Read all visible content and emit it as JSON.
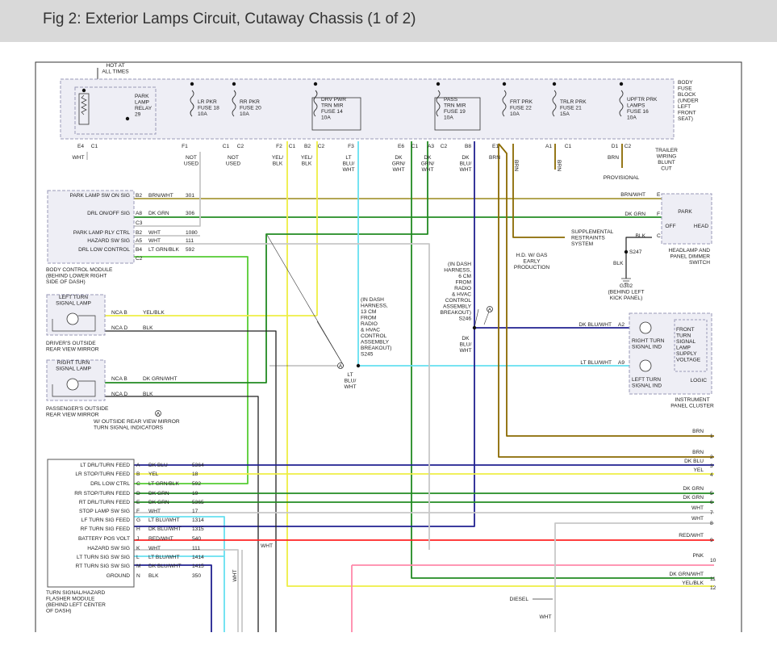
{
  "title": "Fig 2: Exterior Lamps Circuit, Cutaway Chassis (1 of 2)",
  "fuse_block": {
    "hot_label": [
      "HOT AT",
      "ALL TIMES"
    ],
    "relay": [
      "PARK",
      "LAMP",
      "RELAY",
      "29"
    ],
    "fuses": [
      [
        "LR PKR",
        "FUSE 18",
        "10A"
      ],
      [
        "RR PKR",
        "FUSE 20",
        "10A"
      ],
      [
        "DRV PWR",
        "TRN MIR",
        "FUSE 14",
        "10A"
      ],
      [
        "PASS",
        "TRN MIR",
        "FUSE 19",
        "10A"
      ],
      [
        "FRT PRK",
        "FUSE 22",
        "10A"
      ],
      [
        "TRLR PRK",
        "FUSE 21",
        "15A"
      ],
      [
        "UPFTR PRK",
        "LAMPS",
        "FUSE 16",
        "10A"
      ]
    ],
    "block_label": [
      "BODY",
      "FUSE",
      "BLOCK",
      "(UNDER",
      "LEFT",
      "FRONT",
      "SEAT)"
    ],
    "pins": [
      "E4",
      "C1",
      "F1",
      "C1",
      "C2",
      "F2",
      "C1",
      "B2",
      "C2",
      "F3",
      "E6",
      "C1",
      "A3",
      "C2",
      "B8",
      "E1",
      "A1",
      "C1",
      "D1",
      "C2"
    ],
    "wire_labels": [
      [
        "WHT"
      ],
      [
        "NOT",
        "USED"
      ],
      [
        "NOT",
        "USED"
      ],
      [
        "YEL/",
        "BLK"
      ],
      [
        "YEL/",
        "BLK"
      ],
      [
        "LT",
        "BLU/",
        "WHT"
      ],
      [
        "DK",
        "GRN/",
        "WHT"
      ],
      [
        "DK",
        "GRN/",
        "WHT"
      ],
      [
        "DK",
        "BLU/",
        "WHT"
      ],
      [
        "BRN"
      ],
      [
        "BRN"
      ],
      [
        "BRN"
      ],
      [
        "BRN"
      ]
    ],
    "trailer": [
      "TRAILER",
      "WIRING",
      "BLUNT",
      "CUT"
    ],
    "provisional": "PROVISIONAL"
  },
  "bcm": {
    "rows": [
      {
        "label": "PARK LAMP SW ON SIG",
        "pin": "B2",
        "wire": "BRN/WHT",
        "num": "301"
      },
      {
        "label": "DRL ON/OFF SIG",
        "pin": "A8",
        "wire": "DK GRN",
        "num": "306"
      },
      {
        "label": "",
        "pin": "C3",
        "wire": "",
        "num": ""
      },
      {
        "label": "PARK LAMP RLY CTRL",
        "pin": "B2",
        "wire": "WHT",
        "num": "1080"
      },
      {
        "label": "HAZARD SW SIG",
        "pin": "A5",
        "wire": "WHT",
        "num": "111"
      },
      {
        "label": "DRL LOW CONTROL",
        "pin": "B4",
        "wire": "LT GRN/BLK",
        "num": "592"
      },
      {
        "label": "",
        "pin": "C2",
        "wire": "",
        "num": ""
      }
    ],
    "caption": [
      "BODY CONTROL MODULE",
      "(BEHIND LOWER RIGHT",
      "SIDE OF DASH)"
    ]
  },
  "mirrors": {
    "left_lamp": [
      "LEFT TURN",
      "SIGNAL LAMP"
    ],
    "left_caption": [
      "DRIVER'S OUTSIDE",
      "REAR VIEW MIRROR"
    ],
    "right_lamp": [
      "RIGHT TURN",
      "SIGNAL LAMP"
    ],
    "right_caption": [
      "PASSENGER'S OUTSIDE",
      "REAR VIEW MIRROR"
    ],
    "pins": [
      "NCA B",
      "NCA D",
      "NCA B",
      "NCA D"
    ],
    "wires": [
      "YEL/BLK",
      "BLK",
      "DK GRN/WHT",
      "BLK"
    ],
    "note_marker": "A",
    "note": [
      "W/ OUTSIDE REAR VIEW MIRROR",
      "TURN SIGNAL INDICATORS"
    ]
  },
  "harness_notes": {
    "s245": [
      "(IN DASH",
      "HARNESS,",
      "13 CM",
      "FROM",
      "RADIO",
      "& HVAC",
      "CONTROL",
      "ASSEMBLY",
      "BREAKOUT)",
      "S245"
    ],
    "s245_wire": [
      "LT",
      "BLU/",
      "WHT"
    ],
    "s246": [
      "(IN DASH",
      "HARNESS,",
      "6 CM",
      "FROM",
      "RADIO",
      "& HVAC",
      "CONTROL",
      "ASSEMBLY",
      "BREAKOUT)",
      "S246"
    ],
    "s246_wire": [
      "DK",
      "BLU/",
      "WHT"
    ],
    "marker": "A"
  },
  "right_side": {
    "srs": [
      "SUPPLEMENTAL",
      "RESTRAINTS",
      "SYSTEM"
    ],
    "hd": [
      "H.D. W/ GAS",
      "EARLY",
      "PRODUCTION"
    ],
    "switch_labels": [
      "PARK",
      "OFF",
      "HEAD"
    ],
    "switch_pins": [
      "E",
      "F",
      "C"
    ],
    "switch_wires": [
      "BRN/WHT",
      "DK GRN",
      "BLK"
    ],
    "switch_caption": [
      "HEADLAMP AND",
      "PANEL DIMMER",
      "SWITCH"
    ],
    "s247": "S247",
    "s247_wire": "BLK",
    "g302": [
      "G302",
      "(BEHIND LEFT",
      "KICK PANEL)"
    ],
    "cluster_wires": [
      "DK BLU/WHT",
      "LT BLU/WHT"
    ],
    "cluster_pins": [
      "A2",
      "A9"
    ],
    "right_ind": [
      "RIGHT TURN",
      "SIGNAL IND"
    ],
    "left_ind": [
      "LEFT TURN",
      "SIGNAL IND"
    ],
    "front_box": [
      "FRONT",
      "TURN",
      "SIGNAL",
      "LAMP",
      "SUPPLY",
      "VOLTAGE"
    ],
    "logic": "LOGIC",
    "cluster_caption": [
      "INSTRUMENT",
      "PANEL CLUSTER"
    ]
  },
  "flasher": {
    "rows": [
      {
        "label": "LT DRL/TURN FEED",
        "pin": "A",
        "wire": "DK BLU",
        "num": "5364"
      },
      {
        "label": "LR STOP/TURN FEED",
        "pin": "B",
        "wire": "YEL",
        "num": "18"
      },
      {
        "label": "DRL LOW CTRL",
        "pin": "C",
        "wire": "LT GRN/BLK",
        "num": "592"
      },
      {
        "label": "RR STOP/TURN FEED",
        "pin": "D",
        "wire": "DK GRN",
        "num": "19"
      },
      {
        "label": "RT DRL/TURN FEED",
        "pin": "E",
        "wire": "DK GRN",
        "num": "5365"
      },
      {
        "label": "STOP LAMP SW SIG",
        "pin": "F",
        "wire": "WHT",
        "num": "17"
      },
      {
        "label": "LF TURN SIG FEED",
        "pin": "G",
        "wire": "LT BLU/WHT",
        "num": "1314"
      },
      {
        "label": "RF TURN SIG FEED",
        "pin": "H",
        "wire": "DK BLU/WHT",
        "num": "1315"
      },
      {
        "label": "BATTERY POS VOLT",
        "pin": "J",
        "wire": "RED/WHT",
        "num": "540"
      },
      {
        "label": "HAZARD SW SIG",
        "pin": "K",
        "wire": "WHT",
        "num": "111"
      },
      {
        "label": "LT TURN SIG SW SIG",
        "pin": "L",
        "wire": "LT BLU/WHT",
        "num": "1414"
      },
      {
        "label": "RT TURN SIG SW SIG",
        "pin": "M",
        "wire": "DK BLU/WHT",
        "num": "1415"
      },
      {
        "label": "GROUND",
        "pin": "N",
        "wire": "BLK",
        "num": "350"
      }
    ],
    "caption": [
      "TURN SIGNAL/HAZARD",
      "FLASHER MODULE",
      "(BEHIND LEFT CENTER",
      "OF DASH)"
    ],
    "wht_vertical": "WHT",
    "wht_label": "WHT"
  },
  "outputs": [
    {
      "wire": "BRN",
      "num": "1"
    },
    {
      "wire": "BRN",
      "num": "2"
    },
    {
      "wire": "DK BLU",
      "num": "3"
    },
    {
      "wire": "YEL",
      "num": "4"
    },
    {
      "wire": "DK GRN",
      "num": "5"
    },
    {
      "wire": "DK GRN",
      "num": "6"
    },
    {
      "wire": "WHT",
      "num": "7"
    },
    {
      "wire": "WHT",
      "num": "8"
    },
    {
      "wire": "RED/WHT",
      "num": "9"
    },
    {
      "wire": "PNK",
      "num": "10"
    },
    {
      "wire": "DK GRN/WHT",
      "num": "11"
    },
    {
      "wire": "YEL/BLK",
      "num": "12"
    }
  ],
  "diesel": "DIESEL",
  "diesel_wire": "WHT",
  "colors": {
    "brn": "#8a6a00",
    "brn_wht": "#a89a3c",
    "dk_grn": "#228b22",
    "lt_grn": "#55cc33",
    "yel": "#eeee44",
    "dk_blu": "#202090",
    "lt_blu": "#66e0f0",
    "wht": "#c8c8c8",
    "red": "#ff2222",
    "pnk": "#ff88aa",
    "blk": "#222222",
    "box": "#9a9ab8",
    "box_fill": "#eeeef5"
  }
}
